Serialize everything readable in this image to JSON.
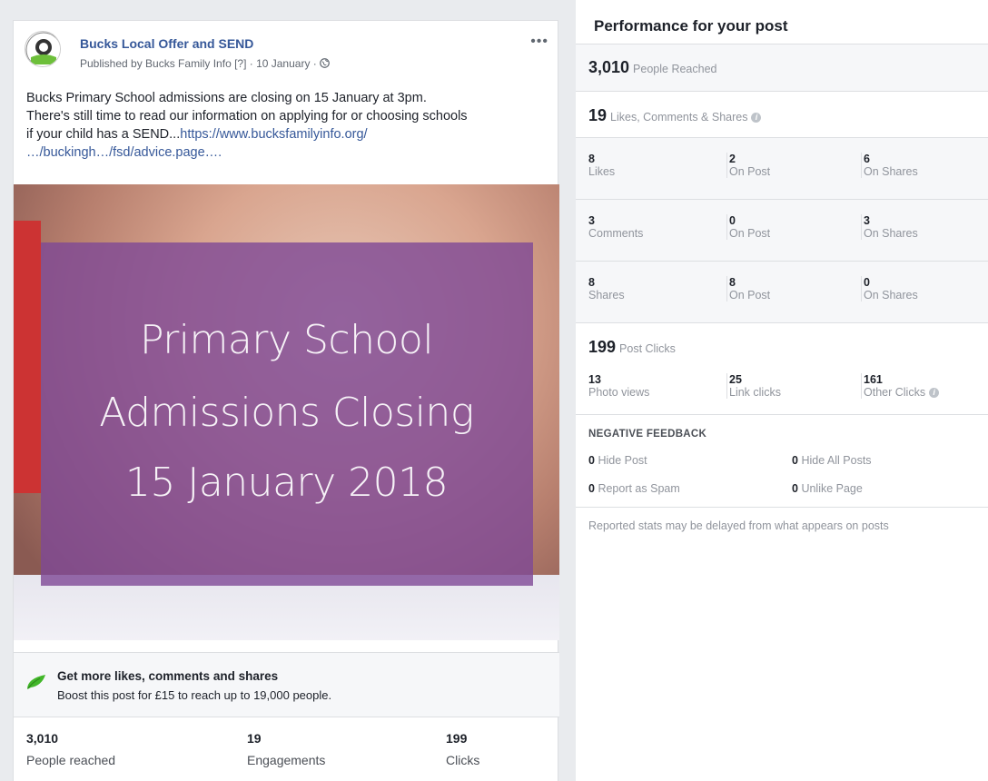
{
  "post": {
    "page_name": "Bucks Local Offer and SEND",
    "byline": "Published by Bucks Family Info [?] · 10 January · ",
    "more": "•••",
    "text_line1": "Bucks Primary School admissions are closing on 15 January at 3pm.",
    "text_line2": "There's still time to read our information on applying for or choosing schools",
    "text_line3_prefix": "if your child has a SEND...",
    "text_link1": "https://www.bucksfamilyinfo.org/",
    "text_link2": "…/buckingh…/fsd/advice.page….",
    "image_lines": [
      "Primary School",
      "Admissions Closing",
      "15 January 2018"
    ],
    "boost_title": "Get more likes, comments and shares",
    "boost_sub": "Boost this post for £15 to reach up to 19,000 people.",
    "stats": [
      {
        "value": "3,010",
        "label": "People reached"
      },
      {
        "value": "19",
        "label": "Engagements"
      },
      {
        "value": "199",
        "label": "Clicks"
      }
    ]
  },
  "performance": {
    "title": "Performance for your post",
    "reached_num": "3,010",
    "reached_label": "People Reached",
    "engage_num": "19",
    "engage_label": "Likes, Comments & Shares",
    "grid": [
      [
        {
          "n": "8",
          "l": "Likes"
        },
        {
          "n": "2",
          "l": "On Post"
        },
        {
          "n": "6",
          "l": "On Shares"
        }
      ],
      [
        {
          "n": "3",
          "l": "Comments"
        },
        {
          "n": "0",
          "l": "On Post"
        },
        {
          "n": "3",
          "l": "On Shares"
        }
      ],
      [
        {
          "n": "8",
          "l": "Shares"
        },
        {
          "n": "8",
          "l": "On Post"
        },
        {
          "n": "0",
          "l": "On Shares"
        }
      ]
    ],
    "clicks_num": "199",
    "clicks_label": "Post Clicks",
    "clicks": [
      {
        "n": "13",
        "l": "Photo views"
      },
      {
        "n": "25",
        "l": "Link clicks"
      },
      {
        "n": "161",
        "l": "Other Clicks"
      }
    ],
    "negative_title": "NEGATIVE FEEDBACK",
    "negative": [
      {
        "n": "0",
        "l": "Hide Post"
      },
      {
        "n": "0",
        "l": "Hide All Posts"
      },
      {
        "n": "0",
        "l": "Report as Spam"
      },
      {
        "n": "0",
        "l": "Unlike Page"
      }
    ],
    "footnote": "Reported stats may be delayed from what appears on posts"
  },
  "colors": {
    "link": "#365899",
    "overlay": "#7e4996",
    "leaf": "#42b72a"
  },
  "icons": [
    "globe-icon",
    "leaf-icon",
    "info-icon",
    "more-icon"
  ]
}
